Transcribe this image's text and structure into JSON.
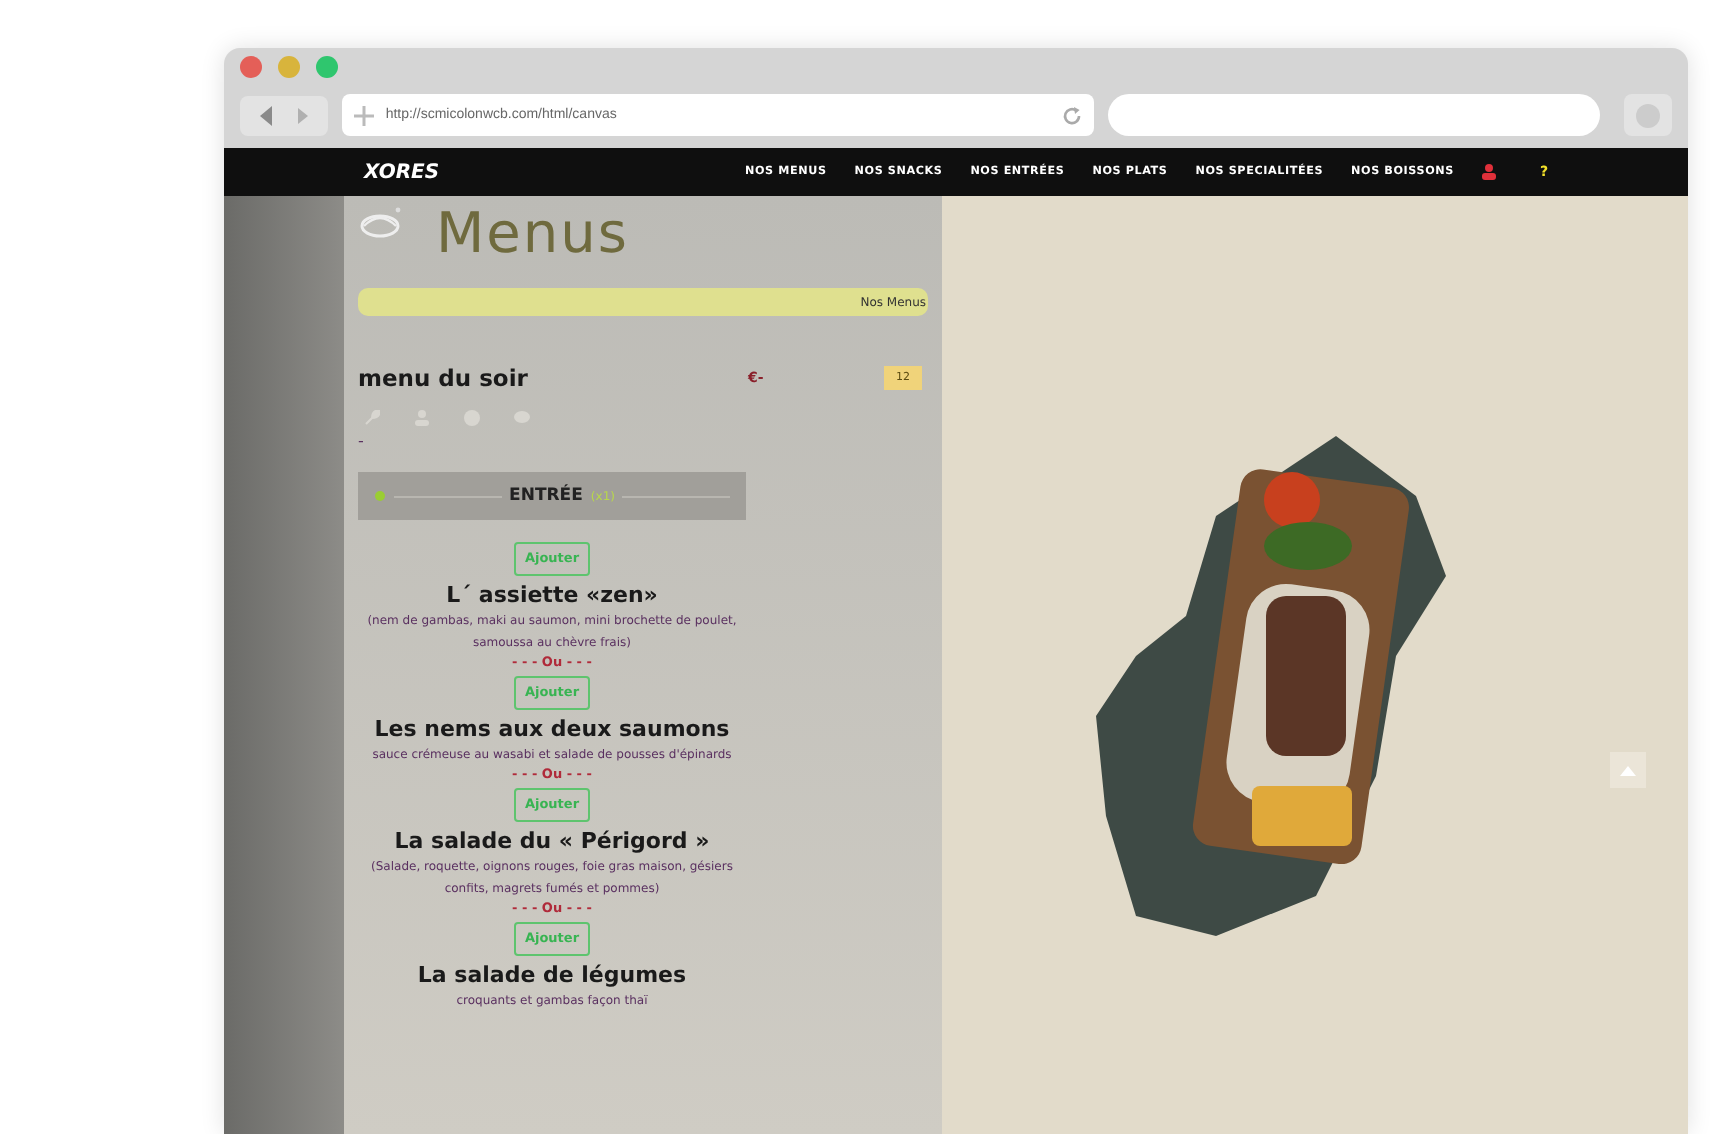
{
  "browser": {
    "url": "http://scmicolonwcb.com/html/canvas"
  },
  "nav": {
    "logo": "XORES",
    "items": [
      "NOS MENUS",
      "NOS SNACKS",
      "NOS ENTRÉES",
      "NOS PLATS",
      "NOS SPECIALITÉES",
      "NOS BOISSONS"
    ],
    "help": "?"
  },
  "page": {
    "title": "Menus",
    "breadcrumb": "Nos Menus"
  },
  "menu": {
    "name": "menu du soir",
    "price": "€-",
    "badge": "12",
    "note": "-"
  },
  "section": {
    "title": "ENTRÉE",
    "count": "(x1)"
  },
  "dishes": [
    {
      "button": "Ajouter",
      "name": "L´ assiette «zen»",
      "description": "(nem de gambas, maki au saumon, mini brochette de poulet, samoussa au chèvre frais)",
      "separator": "- - - Ou - - -"
    },
    {
      "button": "Ajouter",
      "name": "Les nems aux deux saumons",
      "description": "sauce crémeuse au wasabi et salade de pousses d'épinards",
      "separator": "- - - Ou - - -"
    },
    {
      "button": "Ajouter",
      "name": "La salade du « Périgord »",
      "description": "(Salade, roquette, oignons rouges, foie gras maison, gésiers confits, magrets fumés et pommes)",
      "separator": "- - - Ou - - -"
    },
    {
      "button": "Ajouter",
      "name": "La salade de légumes",
      "description": "croquants et gambas façon thaï"
    }
  ]
}
